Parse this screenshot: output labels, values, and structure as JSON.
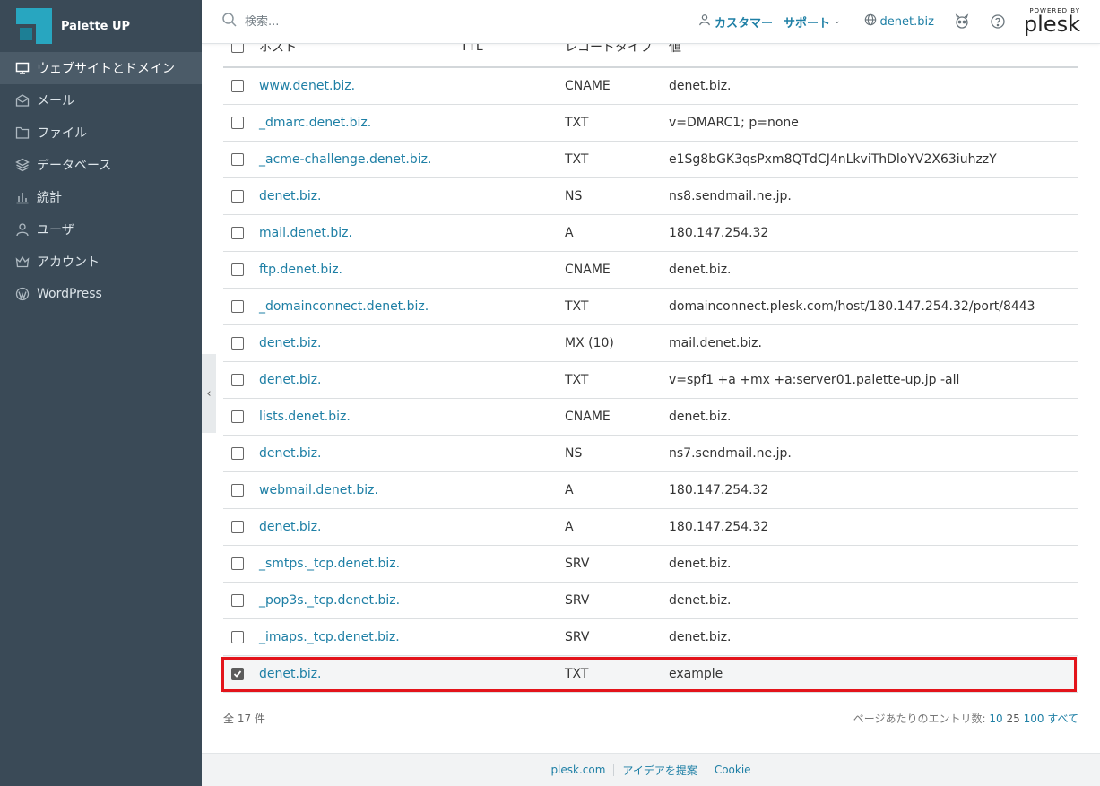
{
  "brand": {
    "name": "Palette UP"
  },
  "sidebar": {
    "items": [
      {
        "label": "ウェブサイトとドメイン",
        "icon": "monitor-icon",
        "active": true
      },
      {
        "label": "メール",
        "icon": "mail-icon"
      },
      {
        "label": "ファイル",
        "icon": "folder-icon"
      },
      {
        "label": "データベース",
        "icon": "layers-icon"
      },
      {
        "label": "統計",
        "icon": "bar-chart-icon"
      },
      {
        "label": "ユーザ",
        "icon": "user-icon"
      },
      {
        "label": "アカウント",
        "icon": "crown-icon"
      },
      {
        "label": "WordPress",
        "icon": "wordpress-icon"
      }
    ]
  },
  "header": {
    "search_placeholder": "検索...",
    "customer_label": "カスタマー",
    "support_label": "サポート",
    "domain_label": "denet.biz",
    "powered_by": "POWERED BY",
    "plesk": "plesk"
  },
  "table": {
    "columns": {
      "host": "ホスト",
      "ttl": "TTL",
      "type": "レコードタイプ",
      "value": "値"
    },
    "rows": [
      {
        "host": "www.denet.biz.",
        "ttl": "",
        "type": "CNAME",
        "value": "denet.biz.",
        "checked": false
      },
      {
        "host": "_dmarc.denet.biz.",
        "ttl": "",
        "type": "TXT",
        "value": "v=DMARC1; p=none",
        "checked": false
      },
      {
        "host": "_acme-challenge.denet.biz.",
        "ttl": "",
        "type": "TXT",
        "value": "e1Sg8bGK3qsPxm8QTdCJ4nLkviThDloYV2X63iuhzzY",
        "checked": false
      },
      {
        "host": "denet.biz.",
        "ttl": "",
        "type": "NS",
        "value": "ns8.sendmail.ne.jp.",
        "checked": false
      },
      {
        "host": "mail.denet.biz.",
        "ttl": "",
        "type": "A",
        "value": "180.147.254.32",
        "checked": false
      },
      {
        "host": "ftp.denet.biz.",
        "ttl": "",
        "type": "CNAME",
        "value": "denet.biz.",
        "checked": false
      },
      {
        "host": "_domainconnect.denet.biz.",
        "ttl": "",
        "type": "TXT",
        "value": "domainconnect.plesk.com/host/180.147.254.32/port/8443",
        "checked": false
      },
      {
        "host": "denet.biz.",
        "ttl": "",
        "type": "MX (10)",
        "value": "mail.denet.biz.",
        "checked": false
      },
      {
        "host": "denet.biz.",
        "ttl": "",
        "type": "TXT",
        "value": "v=spf1 +a +mx +a:server01.palette-up.jp -all",
        "checked": false
      },
      {
        "host": "lists.denet.biz.",
        "ttl": "",
        "type": "CNAME",
        "value": "denet.biz.",
        "checked": false
      },
      {
        "host": "denet.biz.",
        "ttl": "",
        "type": "NS",
        "value": "ns7.sendmail.ne.jp.",
        "checked": false
      },
      {
        "host": "webmail.denet.biz.",
        "ttl": "",
        "type": "A",
        "value": "180.147.254.32",
        "checked": false
      },
      {
        "host": "denet.biz.",
        "ttl": "",
        "type": "A",
        "value": "180.147.254.32",
        "checked": false
      },
      {
        "host": "_smtps._tcp.denet.biz.",
        "ttl": "",
        "type": "SRV",
        "value": "denet.biz.",
        "checked": false
      },
      {
        "host": "_pop3s._tcp.denet.biz.",
        "ttl": "",
        "type": "SRV",
        "value": "denet.biz.",
        "checked": false
      },
      {
        "host": "_imaps._tcp.denet.biz.",
        "ttl": "",
        "type": "SRV",
        "value": "denet.biz.",
        "checked": false
      },
      {
        "host": "denet.biz.",
        "ttl": "",
        "type": "TXT",
        "value": "example",
        "checked": true
      }
    ]
  },
  "pagination": {
    "total": "全 17 件",
    "per_page_label": "ページあたりのエントリ数:",
    "options": [
      "10",
      "25",
      "100",
      "すべて"
    ]
  },
  "footer": {
    "links": [
      "plesk.com",
      "アイデアを提案",
      "Cookie"
    ]
  },
  "colors": {
    "sidebar_bg": "#3a4a57",
    "link": "#1e7fa5",
    "highlight": "#e3141b",
    "brand": "#28a6c0"
  }
}
